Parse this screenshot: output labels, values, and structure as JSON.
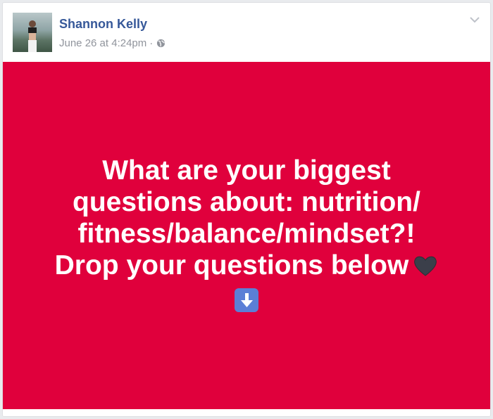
{
  "post": {
    "author_name": "Shannon Kelly",
    "timestamp": "June 26 at 4:24pm",
    "separator": "·",
    "privacy_icon": "globe-icon",
    "options_icon": "chevron-down-icon",
    "avatar_icon": "profile-photo"
  },
  "banner": {
    "background_color": "#e0003c",
    "text_color": "#ffffff",
    "lines": [
      "What are your biggest",
      "questions about: nutrition/",
      "fitness/balance/mindset?!",
      "Drop your questions below"
    ],
    "heart_icon": "black-heart-emoji",
    "arrow_icon": "down-arrow-emoji"
  },
  "colors": {
    "author_link": "#365899",
    "meta_text": "#90949c",
    "arrow_box": "#5b7fd6",
    "heart": "#3b3f4a"
  }
}
